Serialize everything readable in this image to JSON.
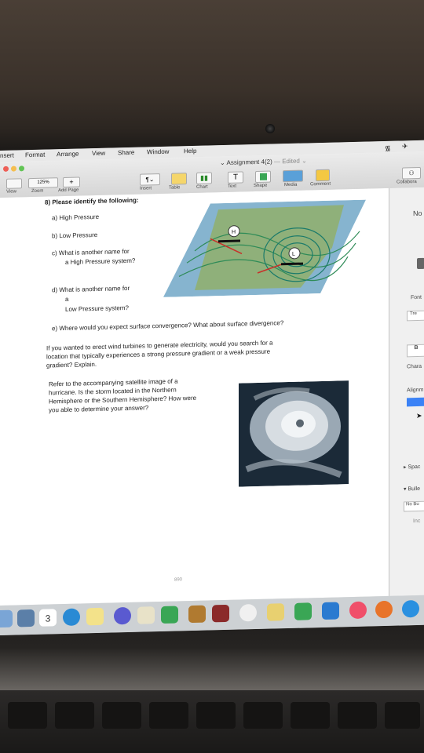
{
  "menubar": {
    "items": [
      "nsert",
      "Format",
      "Arrange",
      "View",
      "Share",
      "Window",
      "Help"
    ]
  },
  "document": {
    "title": "Assignment 4(2)",
    "edited": "— Edited ⌄"
  },
  "toolbar": {
    "zoom_value": "125%",
    "buttons": [
      "View",
      "Zoom",
      "Add Page",
      "Insert",
      "Table",
      "Chart",
      "Text",
      "Shape",
      "Media",
      "Comment"
    ],
    "collaborate": "Collabora"
  },
  "content": {
    "heading": "8) Please identify the following:",
    "a": "a)  High Pressure",
    "b": "b)  Low Pressure",
    "c1": "c)  What is another name for",
    "c2": "a High Pressure system?",
    "d1": "d)  What is another name for",
    "d2": "a",
    "d3": "Low Pressure system?",
    "e": "e)  Where would you expect surface convergence? What about surface divergence?",
    "wind1": "If you wanted to erect wind turbines to generate electricity, would you search for a",
    "wind2": "location that typically experiences a strong pressure gradient or a weak pressure",
    "wind3": "gradient? Explain.",
    "sat1": "Refer to the accompanying satellite image of a",
    "sat2": "hurricane.  Is the storm located in the Northern",
    "sat3": "Hemisphere or the Southern Hemisphere? How were",
    "sat4": "you able to determine your answer?",
    "map_h": "H",
    "map_l": "L",
    "word_count": "890"
  },
  "sidebar": {
    "no": "No",
    "font": "Font",
    "tre": "Tre",
    "b": "B",
    "chara": "Chara",
    "align": "Alignm",
    "spac": "Spac",
    "bulle": "Bulle",
    "nobu": "No Bu",
    "inc": "Inc"
  },
  "dock": {
    "calendar_badge": "3"
  },
  "colors": {
    "map_land": "#7aa06a",
    "map_water": "#7fb7d6",
    "accent": "#3b82f6"
  }
}
